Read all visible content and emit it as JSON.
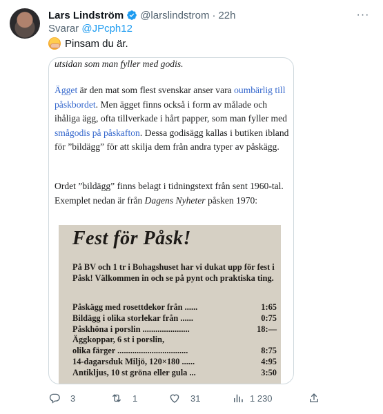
{
  "tweet": {
    "display_name": "Lars Lindström",
    "handle": "@larslindstrom",
    "separator": "·",
    "time": "22h",
    "more_label": "···",
    "reply_prefix": "Svarar",
    "reply_to": "@JPcph12",
    "text": "Pinsam du är.",
    "emoji": "hugging-face"
  },
  "document": {
    "p0": "utsidan som man fyller med godis.",
    "p1_a": "Ägget",
    "p1_b": " är den mat som flest svenskar anser vara ",
    "p1_c": "oumbärlig till påskbordet",
    "p1_d": ". Men ägget finns också i form av målade och ihåliga ägg, ofta tillverkade i hårt papper, som man fyller med ",
    "p1_e": "smågodis på påskafton",
    "p1_f": ". Dessa godisägg kallas i butiken ibland för ”bildägg” för att skilja dem från andra typer av påskägg.",
    "p2_a": "Ordet ”bildägg” finns belagt i tidningstext från sent 1960-tal. Exemplet nedan är från ",
    "p2_b": "Dagens Nyheter",
    "p2_c": " påsken 1970:"
  },
  "clipping": {
    "title": "Fest för Påsk!",
    "intro": "På BV och 1 tr i Bohagshuset har vi dukat upp för fest i Påsk! Välkommen in och se på pynt och praktiska ting.",
    "rows": [
      {
        "item": "Påskägg med rosettdekor från ......",
        "price": "1:65"
      },
      {
        "item": "Bildägg i olika storlekar från ......",
        "price": "0:75"
      },
      {
        "item": "Påskhöna i porslin ......................",
        "price": "18:—"
      },
      {
        "item": "Äggkoppar, 6 st i porslin,",
        "price": ""
      },
      {
        "item": "olika färger .................................",
        "price": "8:75"
      },
      {
        "item": "14-dagarsduk Miljö, 120×180 ......",
        "price": "4:95"
      },
      {
        "item": "Antikljus, 10 st gröna eller gula ...",
        "price": "3:50"
      }
    ]
  },
  "actions": {
    "replies": "3",
    "retweets": "1",
    "likes": "31",
    "views": "1 230"
  },
  "colors": {
    "link": "#1d9bf0",
    "verified": "#1d9bf0",
    "muted": "#536471",
    "wiki_link": "#3366cc"
  }
}
